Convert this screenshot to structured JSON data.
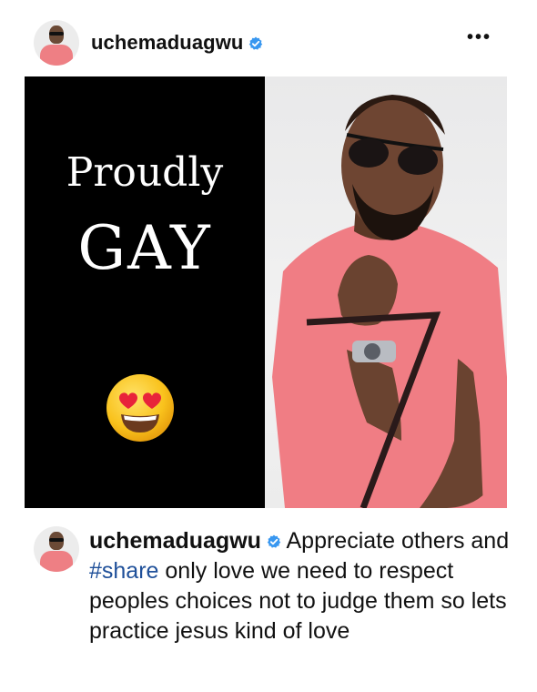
{
  "post": {
    "username": "uchemaduagwu",
    "more_label": "•••",
    "image": {
      "line1": "Proudly",
      "line2": "GAY",
      "emoji": "smiling-face-with-heart-eyes"
    },
    "caption": {
      "username": "uchemaduagwu",
      "part1": "Appreciate others and ",
      "hashtag": "#share",
      "part2": " only love we need to respect peoples choices not to judge them so lets practice jesus kind of love"
    }
  },
  "colors": {
    "verified": "#3897f0",
    "hashtag": "#1e4f99",
    "shirt": "#f07d84",
    "background": "#ffffff"
  }
}
